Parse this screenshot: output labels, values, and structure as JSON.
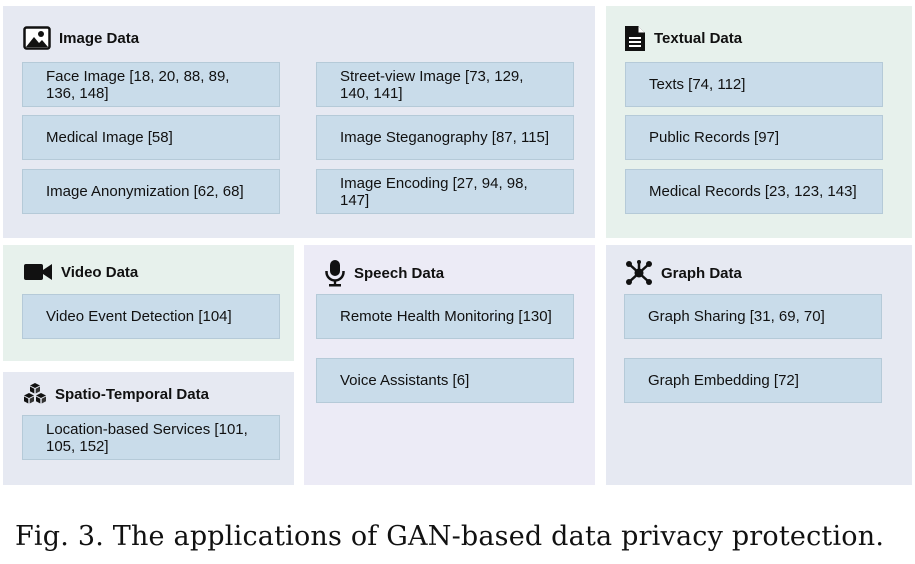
{
  "panels": {
    "image": {
      "title": "Image Data",
      "col1": [
        "Face Image [18, 20, 88, 89, 136, 148]",
        "Medical Image [58]",
        "Image Anonymization [62, 68]"
      ],
      "col2": [
        "Street-view Image [73, 129, 140, 141]",
        "Image Steganography [87, 115]",
        "Image Encoding [27, 94, 98, 147]"
      ]
    },
    "textual": {
      "title": "Textual Data",
      "items": [
        "Texts [74, 112]",
        "Public Records [97]",
        "Medical Records [23, 123, 143]"
      ]
    },
    "video": {
      "title": "Video Data",
      "items": [
        "Video Event Detection [104]"
      ]
    },
    "spatio": {
      "title": "Spatio-Temporal Data",
      "items": [
        " Location-based Services [101, 105, 152]"
      ]
    },
    "speech": {
      "title": "Speech Data",
      "items": [
        "Remote Health Monitoring [130]",
        "Voice Assistants [6]"
      ]
    },
    "graph": {
      "title": "Graph Data",
      "items": [
        "Graph Sharing [31, 69, 70]",
        "Graph Embedding [72]"
      ]
    }
  },
  "caption": "Fig. 3.  The applications of GAN-based data privacy protection.",
  "icons": {
    "image": "image-icon",
    "textual": "document-icon",
    "video": "video-camera-icon",
    "spatio": "cubes-icon",
    "speech": "microphone-icon",
    "graph": "graph-icon"
  },
  "colors": {
    "image_panel": "#e6e9f2",
    "textual_panel": "#e7f1ec",
    "video_panel": "#e7f1ec",
    "speech_panel": "#ecebf6",
    "item_fill": "#c9dcea"
  }
}
